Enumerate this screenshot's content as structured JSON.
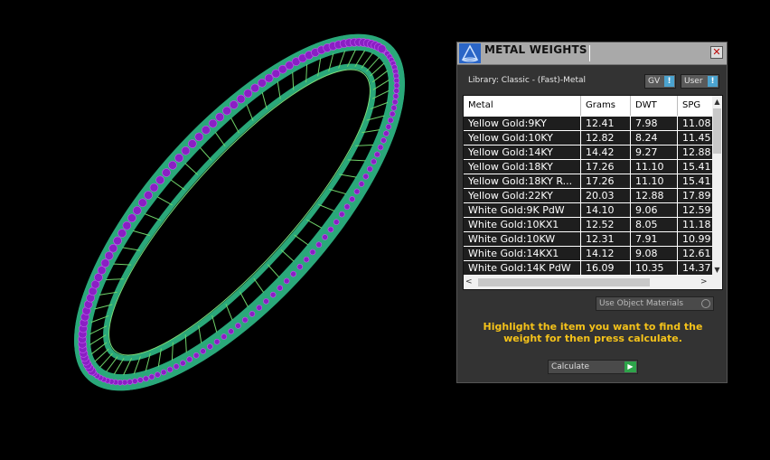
{
  "panel": {
    "title": "METAL WEIGHTS",
    "close_glyph": "✕",
    "library_label": "Library: Classic - (Fast)-Metal",
    "gv_dropdown": "GV",
    "user_dropdown": "User",
    "columns": [
      "Metal",
      "Grams",
      "DWT",
      "SPG"
    ],
    "rows": [
      [
        "Yellow Gold:9KY",
        "12.41",
        "7.98",
        "11.08"
      ],
      [
        "Yellow Gold:10KY",
        "12.82",
        "8.24",
        "11.45"
      ],
      [
        "Yellow Gold:14KY",
        "14.42",
        "9.27",
        "12.88"
      ],
      [
        "Yellow Gold:18KY",
        "17.26",
        "11.10",
        "15.41"
      ],
      [
        "Yellow Gold:18KY R...",
        "17.26",
        "11.10",
        "15.41"
      ],
      [
        "Yellow Gold:22KY",
        "20.03",
        "12.88",
        "17.89"
      ],
      [
        "White Gold:9K PdW",
        "14.10",
        "9.06",
        "12.59"
      ],
      [
        "White Gold:10KX1",
        "12.52",
        "8.05",
        "11.18"
      ],
      [
        "White Gold:10KW",
        "12.31",
        "7.91",
        "10.99"
      ],
      [
        "White Gold:14KX1",
        "14.12",
        "9.08",
        "12.61"
      ],
      [
        "White Gold:14K PdW",
        "16.09",
        "10.35",
        "14.37"
      ]
    ],
    "scroll_up": "▲",
    "scroll_down": "▼",
    "scroll_left": "<",
    "scroll_right": ">",
    "use_object_materials": "Use Object Materials",
    "hint": "Highlight the item you want to find the weight for then press calculate.",
    "calculate": "Calculate",
    "calculate_glyph": "▶"
  },
  "colors": {
    "panel_bg": "#333333",
    "titlebar_bg": "#a9a9a9",
    "row_bg": "#1e1e1e",
    "hint": "#f4c21a",
    "dropdown_btn": "#4ba3cf",
    "calculate_btn": "#2ea44a",
    "wireframe": "#2aa87a",
    "gems": "#8a1fc4"
  },
  "icons": [
    "ring-wireframe-model",
    "metal-weights-app-icon",
    "close-icon",
    "dropdown-icon",
    "radio-icon",
    "play-icon"
  ]
}
